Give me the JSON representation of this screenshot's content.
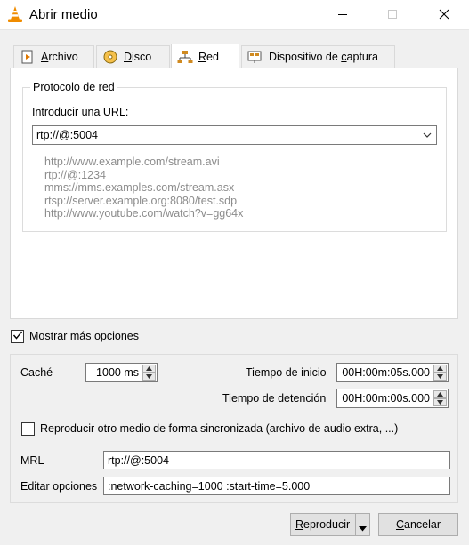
{
  "window": {
    "title": "Abrir medio",
    "controls": [
      "minimize-icon",
      "maximize-icon",
      "close-icon"
    ]
  },
  "tabs": [
    {
      "label_pre": "",
      "label_ul": "A",
      "label_post": "rchivo",
      "icon": "file-play-icon",
      "active": false
    },
    {
      "label_pre": "",
      "label_ul": "D",
      "label_post": "isco",
      "icon": "disc-icon",
      "active": false
    },
    {
      "label_pre": "",
      "label_ul": "R",
      "label_post": "ed",
      "icon": "network-icon",
      "active": true
    },
    {
      "label_pre": "Dispositivo de ",
      "label_ul": "c",
      "label_post": "aptura",
      "icon": "capture-device-icon",
      "active": false
    }
  ],
  "network": {
    "group_title": "Protocolo de red",
    "url_label": "Introducir una URL:",
    "url_value": "rtp://@:5004",
    "examples": [
      "http://www.example.com/stream.avi",
      "rtp://@:1234",
      "mms://mms.examples.com/stream.asx",
      "rtsp://server.example.org:8080/test.sdp",
      "http://www.youtube.com/watch?v=gg64x"
    ]
  },
  "show_more": {
    "checked": true,
    "label_pre": "Mostrar ",
    "label_ul": "m",
    "label_post": "ás opciones"
  },
  "options": {
    "cache_label": "Caché",
    "cache_value": "1000 ms",
    "start_time_label": "Tiempo de inicio",
    "start_time_value": "00H:00m:05s.000",
    "stop_time_label": "Tiempo de detención",
    "stop_time_value": "00H:00m:00s.000",
    "sync_checked": false,
    "sync_label": "Reproducir otro medio de forma sincronizada (archivo de audio extra, ...)",
    "mrl_label": "MRL",
    "mrl_value": "rtp://@:5004",
    "edit_label": "Editar opciones",
    "edit_value": ":network-caching=1000 :start-time=5.000"
  },
  "buttons": {
    "play_ul": "R",
    "play_rest": "eproducir",
    "cancel_ul": "C",
    "cancel_rest": "ancelar"
  }
}
